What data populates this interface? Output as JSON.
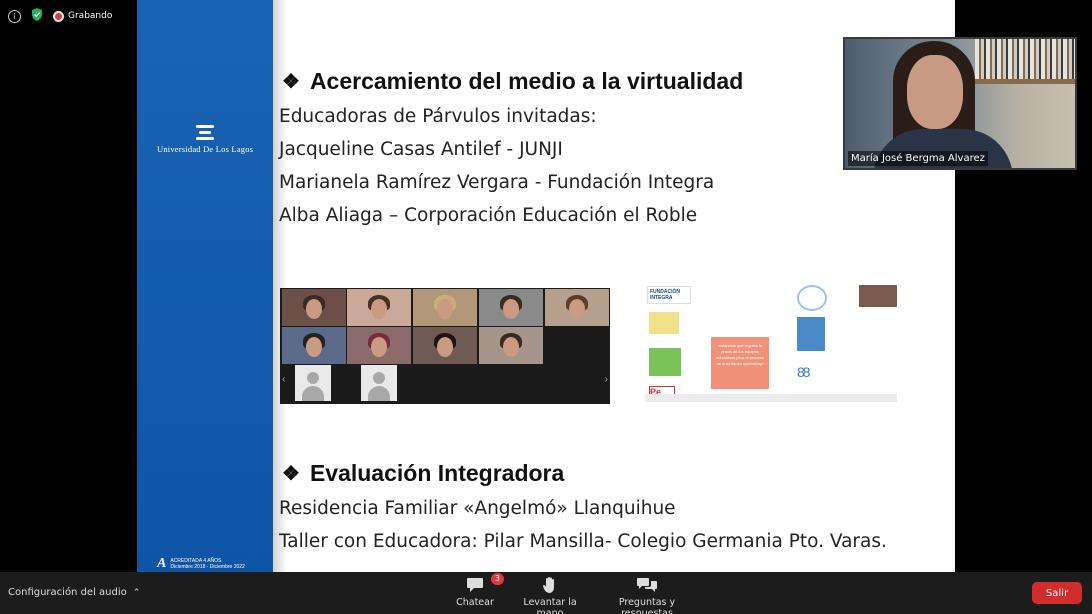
{
  "top": {
    "info_icon": "info-icon",
    "security_icon": "shield-check-icon",
    "recording_label": "Grabando"
  },
  "slide": {
    "university_name": "Universidad De Los Lagos",
    "accreditation": "ACREDITADA 4 AÑOS",
    "accreditation_dates": "Diciembre 2018 - Diciembre 2022",
    "heading1": "Acercamiento del medio a la virtualidad",
    "lines1": [
      "Educadoras de Párvulos invitadas:",
      "Jacqueline Casas Antilef - JUNJI",
      "Marianela Ramírez Vergara - Fundación Integra",
      "Alba Aliaga – Corporación Educación el Roble"
    ],
    "heading2": "Evaluación Integradora",
    "lines2": [
      "Residencia Familiar «Angelmó» Llanquihue",
      "Taller con Educadora: Pilar Mansilla- Colegio Germania Pto. Varas."
    ],
    "diagram_org": "FUNDACIÓN INTEGRA",
    "diagram_center": "Instancias que regulan la praxis de los equipos educativos para el proceso de enseñanza aprendizaje"
  },
  "speaker": {
    "name": "María José Bergma Alvarez"
  },
  "toolbar": {
    "audio_label": "Configuración del audio",
    "chat_label": "Chatear",
    "chat_badge": "3",
    "raise_hand_label": "Levantar la mano",
    "qa_label": "Preguntas y respuestas",
    "leave_label": "Salir"
  },
  "colors": {
    "band_blue": "#1a63b2",
    "leave_red": "#d12d2d",
    "toolbar_bg": "#1c1c1c"
  }
}
